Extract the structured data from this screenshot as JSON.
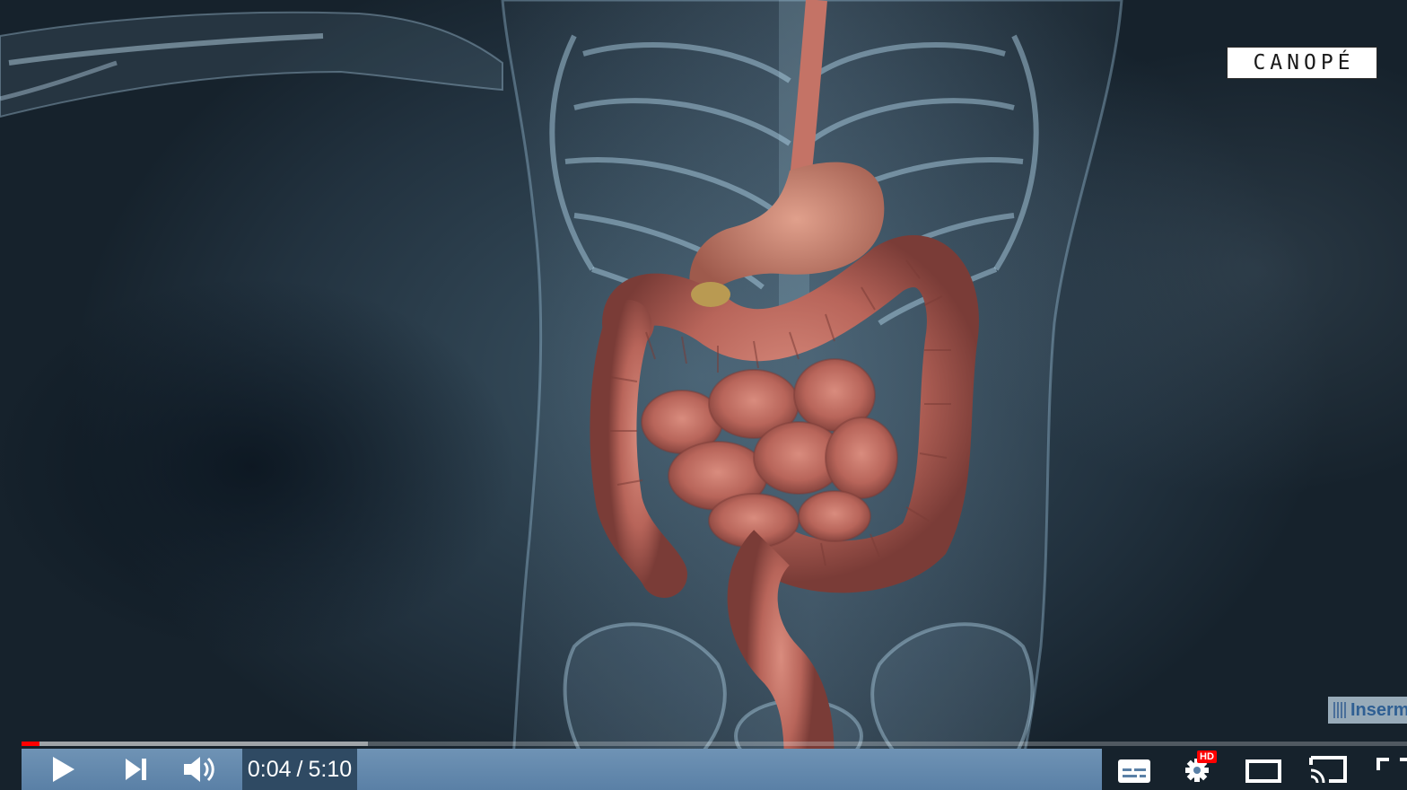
{
  "player": {
    "time": {
      "current": "0:04",
      "separator": "/",
      "duration": "5:10"
    },
    "progress": {
      "played_fraction": 0.013,
      "loaded_fraction": 0.25
    },
    "colors": {
      "played": "#ff0000",
      "hd_badge": "#ff0000",
      "controls_bg": "#6f93b5"
    },
    "settings": {
      "quality_badge": "HD"
    },
    "buttons": [
      {
        "name": "play-button",
        "icon": "play-icon"
      },
      {
        "name": "next-button",
        "icon": "next-icon"
      },
      {
        "name": "mute-button",
        "icon": "volume-icon"
      },
      {
        "name": "subtitles-button",
        "icon": "subtitles-icon"
      },
      {
        "name": "settings-button",
        "icon": "gear-icon"
      },
      {
        "name": "miniplayer-button",
        "icon": "miniplayer-icon"
      },
      {
        "name": "cast-button",
        "icon": "cast-icon"
      },
      {
        "name": "fullscreen-button",
        "icon": "fullscreen-icon"
      }
    ]
  },
  "overlay": {
    "watermark_top": "CANOPÉ",
    "watermark_bottom": "Inserm"
  }
}
